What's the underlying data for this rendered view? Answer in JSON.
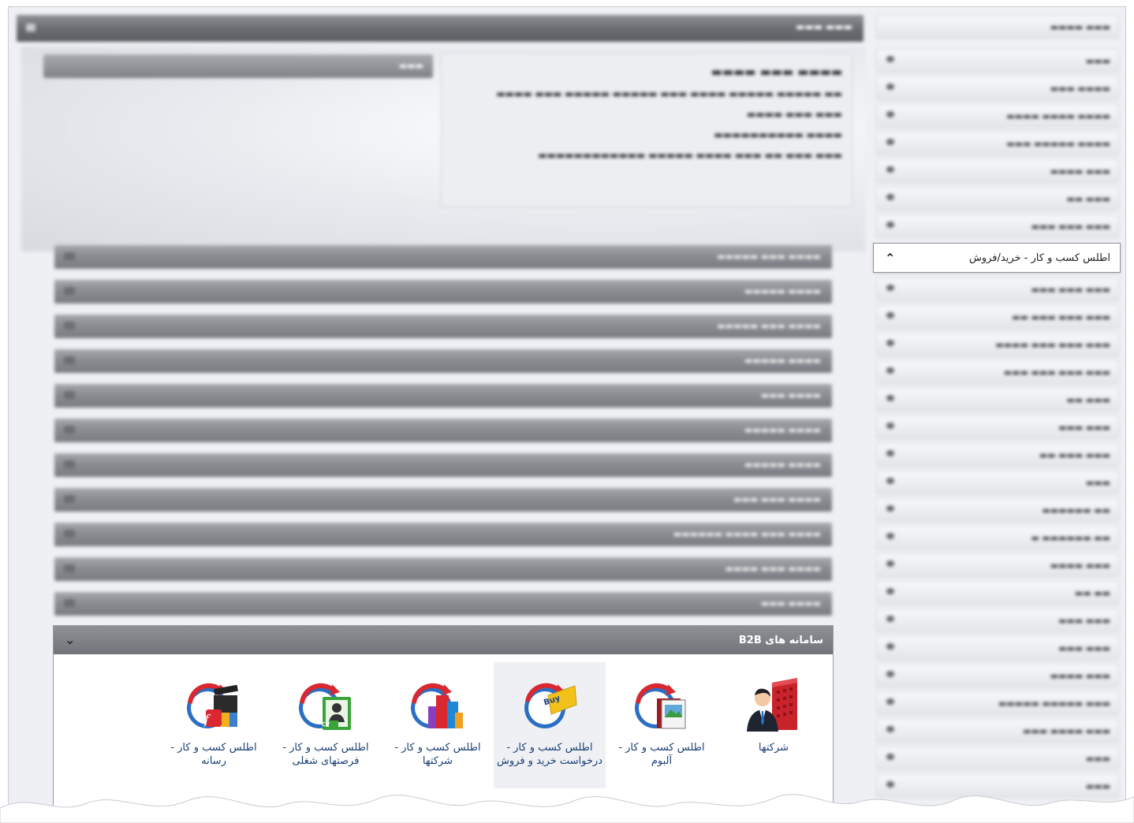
{
  "b2b": {
    "title": "سامانه های B2B",
    "toggle_icon": "chevron-down-icon",
    "tiles": [
      {
        "label": "شرکتها",
        "icon": "company-building-icon",
        "active": false
      },
      {
        "label": "اطلس کسب و کار - آلبوم",
        "icon": "album-icon",
        "active": false
      },
      {
        "label": "اطلس کسب و کار - درخواست خرید و فروش",
        "icon": "buy-sell-icon",
        "active": true
      },
      {
        "label": "اطلس کسب و کار - شرکتها",
        "icon": "companies-icon",
        "active": false
      },
      {
        "label": "اطلس کسب و کار - فرصتهای شغلی",
        "icon": "cv-jobs-icon",
        "active": false
      },
      {
        "label": "اطلس کسب و کار - رسانه",
        "icon": "media-icon",
        "active": false
      }
    ]
  },
  "sidebar": {
    "active_item": {
      "label": "اطلس کسب و کار - خرید/فروش",
      "icon": "chevron-up-icon"
    }
  },
  "colors": {
    "header_bar": "#6a6e73",
    "link_text": "#1b3f78",
    "accent_red": "#d9282f",
    "accent_blue": "#2a6fc4"
  }
}
